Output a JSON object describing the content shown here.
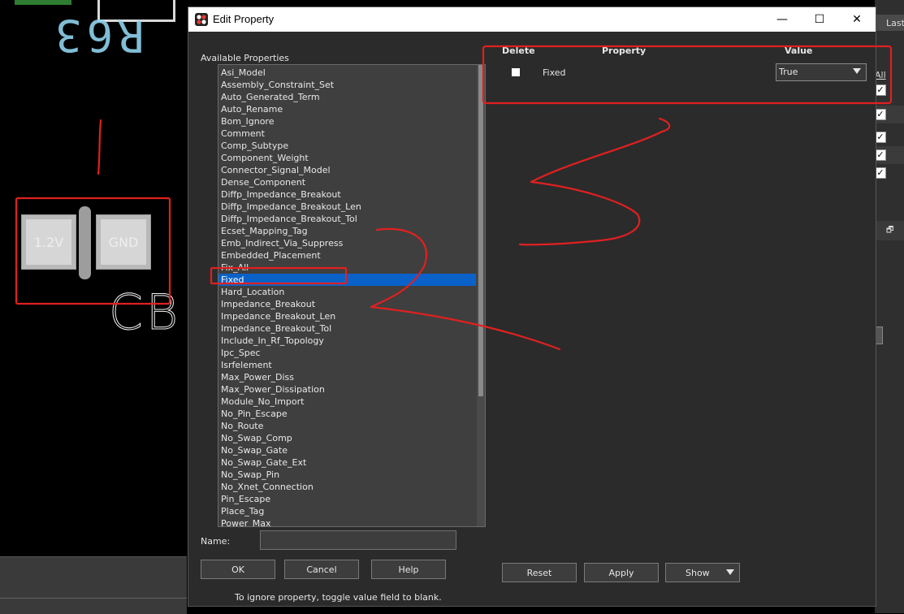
{
  "window": {
    "title": "Edit Property",
    "minimize_glyph": "—",
    "maximize_glyph": "☐",
    "close_glyph": "✕"
  },
  "canvas": {
    "refdes_top": "R63",
    "pad_left_label": "1.2V",
    "pad_right_label": "GND",
    "refdes_bottom": "CB"
  },
  "right_panel": {
    "last_label": "Last",
    "all_label": "All",
    "check_glyph": "✓",
    "float_glyph": "🗗"
  },
  "available": {
    "label": "Available Properties",
    "selected": "Fixed",
    "items": [
      "Asi_Model",
      "Assembly_Constraint_Set",
      "Auto_Generated_Term",
      "Auto_Rename",
      "Bom_Ignore",
      "Comment",
      "Comp_Subtype",
      "Component_Weight",
      "Connector_Signal_Model",
      "Dense_Component",
      "Diffp_Impedance_Breakout",
      "Diffp_Impedance_Breakout_Len",
      "Diffp_Impedance_Breakout_Tol",
      "Ecset_Mapping_Tag",
      "Emb_Indirect_Via_Suppress",
      "Embedded_Placement",
      "Fix_All",
      "Fixed",
      "Hard_Location",
      "Impedance_Breakout",
      "Impedance_Breakout_Len",
      "Impedance_Breakout_Tol",
      "Include_In_Rf_Topology",
      "Ipc_Spec",
      "Isrfelement",
      "Max_Power_Diss",
      "Max_Power_Dissipation",
      "Module_No_Import",
      "No_Pin_Escape",
      "No_Route",
      "No_Swap_Comp",
      "No_Swap_Gate",
      "No_Swap_Gate_Ext",
      "No_Swap_Pin",
      "No_Xnet_Connection",
      "Pin_Escape",
      "Place_Tag",
      "Power_Max"
    ]
  },
  "name_field": {
    "label": "Name:",
    "value": ""
  },
  "table": {
    "headers": {
      "delete": "Delete",
      "property": "Property",
      "value": "Value"
    },
    "rows": [
      {
        "property": "Fixed",
        "value": "True",
        "delete": false
      }
    ]
  },
  "buttons": {
    "ok": "OK",
    "cancel": "Cancel",
    "help": "Help",
    "reset": "Reset",
    "apply": "Apply",
    "show": "Show"
  },
  "status": {
    "help_text": "To ignore property, toggle value field to blank."
  },
  "colors": {
    "dialog_bg": "#2b2b2b",
    "selection": "#0a62c9",
    "annotation": "#e02020",
    "refdes": "#8fd3ee"
  }
}
